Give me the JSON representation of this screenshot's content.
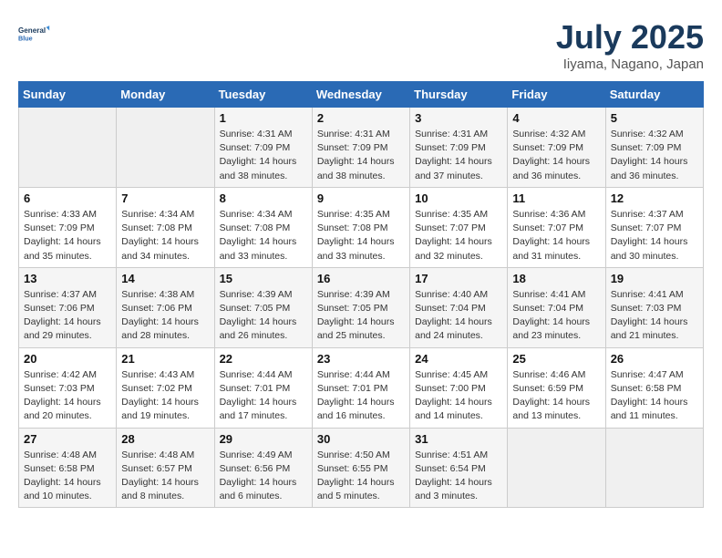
{
  "header": {
    "logo_line1": "General",
    "logo_line2": "Blue",
    "month_title": "July 2025",
    "location": "Iiyama, Nagano, Japan"
  },
  "weekdays": [
    "Sunday",
    "Monday",
    "Tuesday",
    "Wednesday",
    "Thursday",
    "Friday",
    "Saturday"
  ],
  "weeks": [
    [
      {
        "day": "",
        "info": ""
      },
      {
        "day": "",
        "info": ""
      },
      {
        "day": "1",
        "info": "Sunrise: 4:31 AM\nSunset: 7:09 PM\nDaylight: 14 hours\nand 38 minutes."
      },
      {
        "day": "2",
        "info": "Sunrise: 4:31 AM\nSunset: 7:09 PM\nDaylight: 14 hours\nand 38 minutes."
      },
      {
        "day": "3",
        "info": "Sunrise: 4:31 AM\nSunset: 7:09 PM\nDaylight: 14 hours\nand 37 minutes."
      },
      {
        "day": "4",
        "info": "Sunrise: 4:32 AM\nSunset: 7:09 PM\nDaylight: 14 hours\nand 36 minutes."
      },
      {
        "day": "5",
        "info": "Sunrise: 4:32 AM\nSunset: 7:09 PM\nDaylight: 14 hours\nand 36 minutes."
      }
    ],
    [
      {
        "day": "6",
        "info": "Sunrise: 4:33 AM\nSunset: 7:09 PM\nDaylight: 14 hours\nand 35 minutes."
      },
      {
        "day": "7",
        "info": "Sunrise: 4:34 AM\nSunset: 7:08 PM\nDaylight: 14 hours\nand 34 minutes."
      },
      {
        "day": "8",
        "info": "Sunrise: 4:34 AM\nSunset: 7:08 PM\nDaylight: 14 hours\nand 33 minutes."
      },
      {
        "day": "9",
        "info": "Sunrise: 4:35 AM\nSunset: 7:08 PM\nDaylight: 14 hours\nand 33 minutes."
      },
      {
        "day": "10",
        "info": "Sunrise: 4:35 AM\nSunset: 7:07 PM\nDaylight: 14 hours\nand 32 minutes."
      },
      {
        "day": "11",
        "info": "Sunrise: 4:36 AM\nSunset: 7:07 PM\nDaylight: 14 hours\nand 31 minutes."
      },
      {
        "day": "12",
        "info": "Sunrise: 4:37 AM\nSunset: 7:07 PM\nDaylight: 14 hours\nand 30 minutes."
      }
    ],
    [
      {
        "day": "13",
        "info": "Sunrise: 4:37 AM\nSunset: 7:06 PM\nDaylight: 14 hours\nand 29 minutes."
      },
      {
        "day": "14",
        "info": "Sunrise: 4:38 AM\nSunset: 7:06 PM\nDaylight: 14 hours\nand 28 minutes."
      },
      {
        "day": "15",
        "info": "Sunrise: 4:39 AM\nSunset: 7:05 PM\nDaylight: 14 hours\nand 26 minutes."
      },
      {
        "day": "16",
        "info": "Sunrise: 4:39 AM\nSunset: 7:05 PM\nDaylight: 14 hours\nand 25 minutes."
      },
      {
        "day": "17",
        "info": "Sunrise: 4:40 AM\nSunset: 7:04 PM\nDaylight: 14 hours\nand 24 minutes."
      },
      {
        "day": "18",
        "info": "Sunrise: 4:41 AM\nSunset: 7:04 PM\nDaylight: 14 hours\nand 23 minutes."
      },
      {
        "day": "19",
        "info": "Sunrise: 4:41 AM\nSunset: 7:03 PM\nDaylight: 14 hours\nand 21 minutes."
      }
    ],
    [
      {
        "day": "20",
        "info": "Sunrise: 4:42 AM\nSunset: 7:03 PM\nDaylight: 14 hours\nand 20 minutes."
      },
      {
        "day": "21",
        "info": "Sunrise: 4:43 AM\nSunset: 7:02 PM\nDaylight: 14 hours\nand 19 minutes."
      },
      {
        "day": "22",
        "info": "Sunrise: 4:44 AM\nSunset: 7:01 PM\nDaylight: 14 hours\nand 17 minutes."
      },
      {
        "day": "23",
        "info": "Sunrise: 4:44 AM\nSunset: 7:01 PM\nDaylight: 14 hours\nand 16 minutes."
      },
      {
        "day": "24",
        "info": "Sunrise: 4:45 AM\nSunset: 7:00 PM\nDaylight: 14 hours\nand 14 minutes."
      },
      {
        "day": "25",
        "info": "Sunrise: 4:46 AM\nSunset: 6:59 PM\nDaylight: 14 hours\nand 13 minutes."
      },
      {
        "day": "26",
        "info": "Sunrise: 4:47 AM\nSunset: 6:58 PM\nDaylight: 14 hours\nand 11 minutes."
      }
    ],
    [
      {
        "day": "27",
        "info": "Sunrise: 4:48 AM\nSunset: 6:58 PM\nDaylight: 14 hours\nand 10 minutes."
      },
      {
        "day": "28",
        "info": "Sunrise: 4:48 AM\nSunset: 6:57 PM\nDaylight: 14 hours\nand 8 minutes."
      },
      {
        "day": "29",
        "info": "Sunrise: 4:49 AM\nSunset: 6:56 PM\nDaylight: 14 hours\nand 6 minutes."
      },
      {
        "day": "30",
        "info": "Sunrise: 4:50 AM\nSunset: 6:55 PM\nDaylight: 14 hours\nand 5 minutes."
      },
      {
        "day": "31",
        "info": "Sunrise: 4:51 AM\nSunset: 6:54 PM\nDaylight: 14 hours\nand 3 minutes."
      },
      {
        "day": "",
        "info": ""
      },
      {
        "day": "",
        "info": ""
      }
    ]
  ]
}
